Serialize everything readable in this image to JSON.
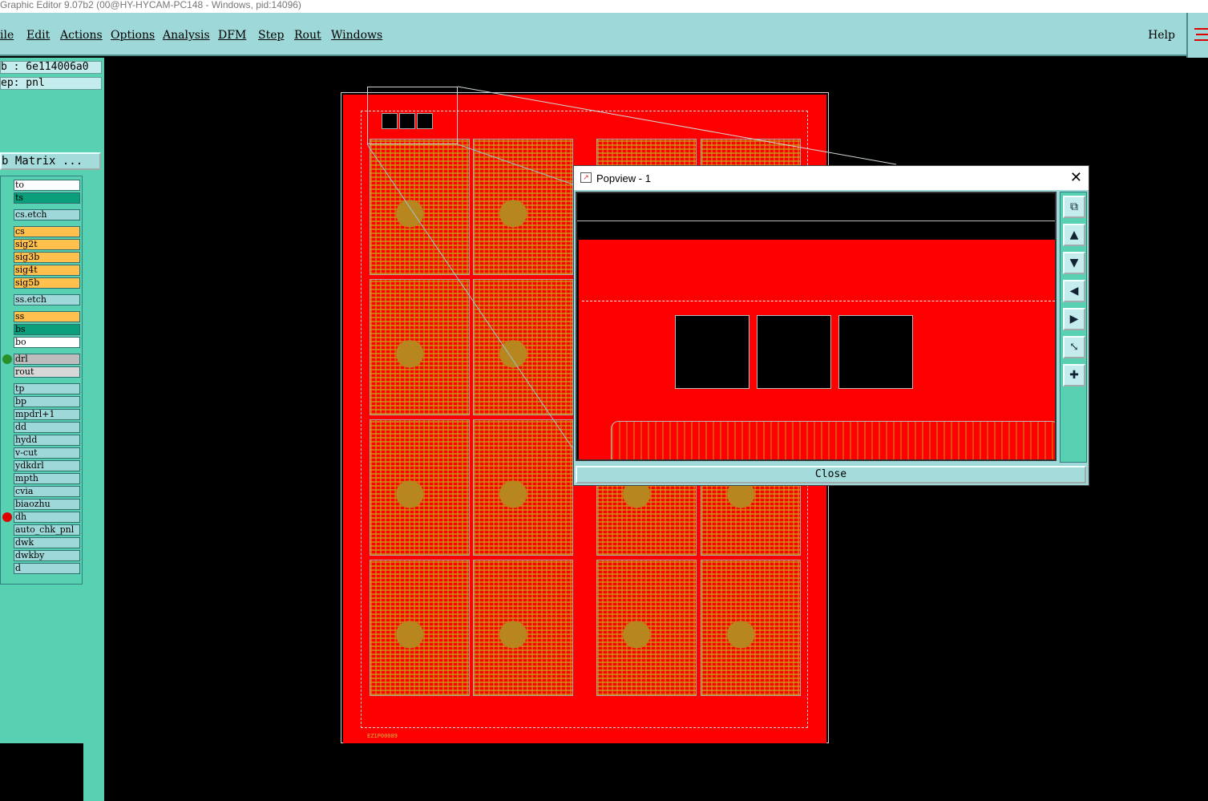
{
  "window": {
    "title": "Graphic Editor 9.07b2 (00@HY-HYCAM-PC148 - Windows, pid:14096)"
  },
  "menu": {
    "items": [
      "ile",
      "Edit",
      "Actions",
      "Options",
      "Analysis",
      "DFM",
      "Step",
      "Rout",
      "Windows"
    ],
    "help": "Help"
  },
  "sidebar": {
    "job": "b : 6e114006a0",
    "step": "ep: pnl",
    "matrix_button": "b Matrix ...",
    "layers": [
      {
        "name": "to",
        "color": "#ffffff"
      },
      {
        "name": "ts",
        "color": "#0a9e7a"
      },
      {
        "name": "cs.etch",
        "color": "#9fd8d8"
      },
      {
        "name": "cs",
        "color": "#ffc04d"
      },
      {
        "name": "sig2t",
        "color": "#ffc04d"
      },
      {
        "name": "sig3b",
        "color": "#ffc04d"
      },
      {
        "name": "sig4t",
        "color": "#ffc04d"
      },
      {
        "name": "sig5b",
        "color": "#ffc04d"
      },
      {
        "name": "ss.etch",
        "color": "#9fd8d8"
      },
      {
        "name": "ss",
        "color": "#ffc04d"
      },
      {
        "name": "bs",
        "color": "#0a9e7a"
      },
      {
        "name": "bo",
        "color": "#ffffff"
      },
      {
        "name": "drl",
        "color": "#bdbdbd",
        "marker": "#2a8f2a"
      },
      {
        "name": "rout",
        "color": "#d8d8d8"
      },
      {
        "name": "tp",
        "color": "#9fd8d8"
      },
      {
        "name": "bp",
        "color": "#9fd8d8"
      },
      {
        "name": "mpdrl+1",
        "color": "#9fd8d8"
      },
      {
        "name": "dd",
        "color": "#9fd8d8"
      },
      {
        "name": "hydd",
        "color": "#9fd8d8"
      },
      {
        "name": "v-cut",
        "color": "#9fd8d8"
      },
      {
        "name": "ydkdrl",
        "color": "#9fd8d8"
      },
      {
        "name": "mpth",
        "color": "#9fd8d8"
      },
      {
        "name": "cvia",
        "color": "#9fd8d8"
      },
      {
        "name": "biaozhu",
        "color": "#9fd8d8"
      },
      {
        "name": "dh",
        "color": "#9fd8d8",
        "marker": "#e00000"
      },
      {
        "name": "auto_chk_pnl",
        "color": "#9fd8d8"
      },
      {
        "name": "dwk",
        "color": "#9fd8d8"
      },
      {
        "name": "dwkby",
        "color": "#9fd8d8"
      },
      {
        "name": "d",
        "color": "#9fd8d8"
      }
    ]
  },
  "popview": {
    "title": "Popview - 1",
    "close_label": "Close",
    "tools": [
      "zoom-fit-icon",
      "pan-up-icon",
      "pan-down-icon",
      "pan-left-icon",
      "pan-right-icon",
      "zoom-out-icon",
      "zoom-in-icon"
    ]
  },
  "board": {
    "label": "EZ1P00089",
    "fill_color": "#ff0000",
    "copper_color": "#c8961a"
  }
}
